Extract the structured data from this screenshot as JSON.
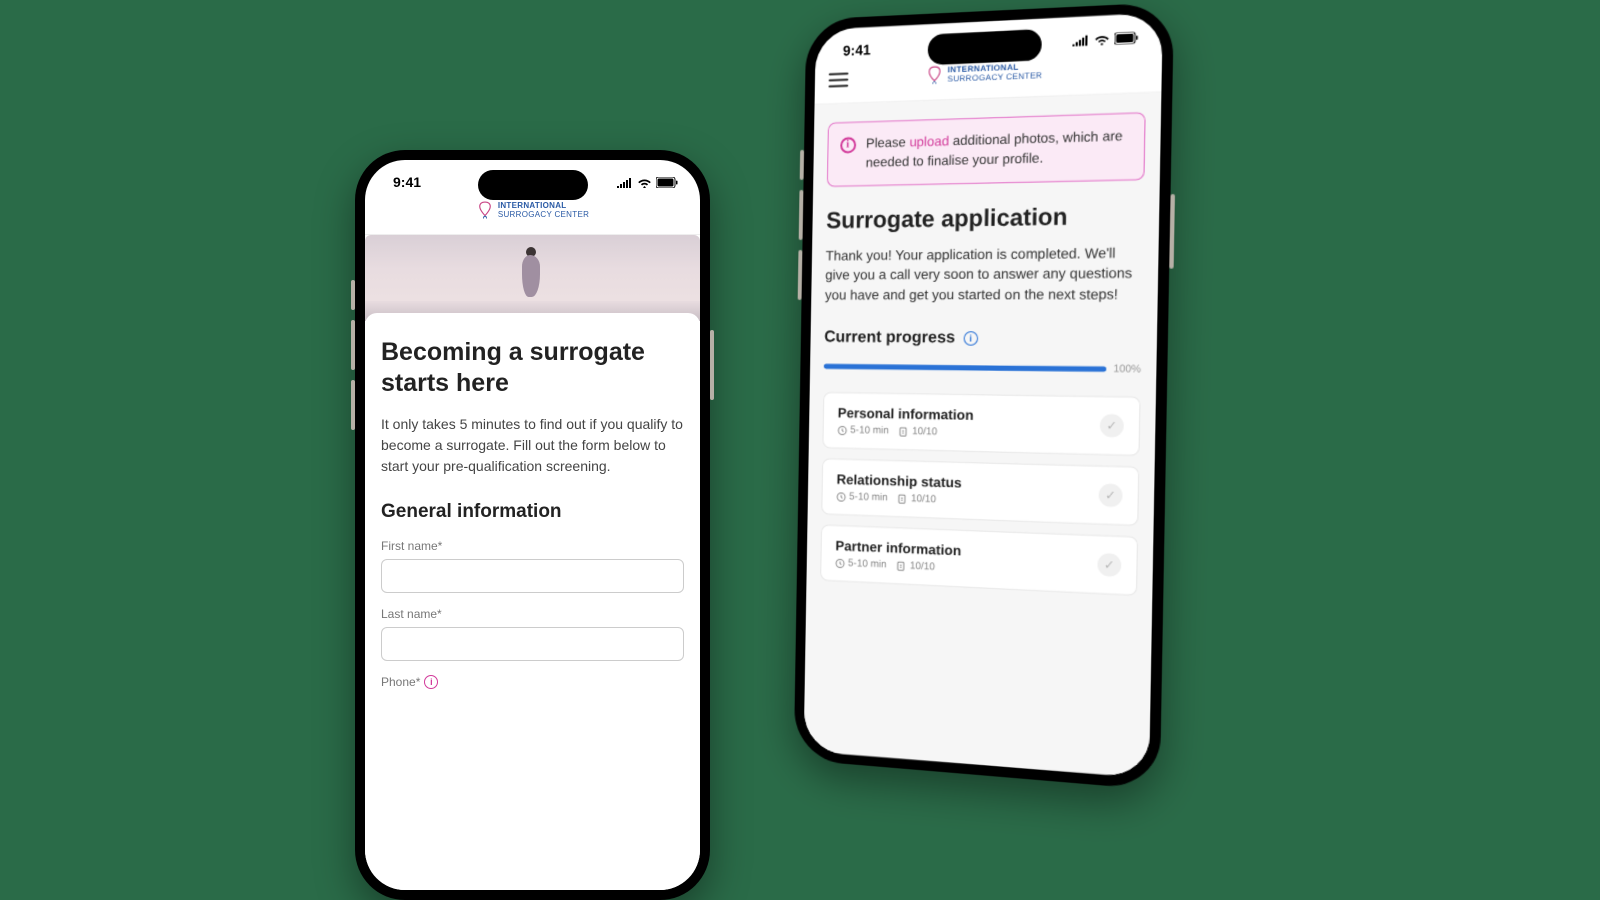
{
  "status": {
    "time": "9:41"
  },
  "logo": {
    "line1": "INTERNATIONAL",
    "line2": "SURROGACY CENTER"
  },
  "left": {
    "title": "Becoming a surrogate starts here",
    "subtitle": "It only takes 5 minutes to find out if you qualify to become a surrogate. Fill out the form below to start your pre-qualification screening.",
    "section": "General information",
    "labels": {
      "first": "First name*",
      "last": "Last name*",
      "phone": "Phone*"
    }
  },
  "right": {
    "alert_pre": "Please ",
    "alert_link": "upload",
    "alert_post": " additional photos, which are needed to finalise your profile.",
    "title": "Surrogate application",
    "body": "Thank you! Your application is completed. We'll give you a call very soon to answer any questions you have and get you started on the next steps!",
    "progress_label": "Current progress",
    "progress_pct": "100%",
    "steps": [
      {
        "title": "Personal information",
        "time": "5-10 min",
        "count": "10/10"
      },
      {
        "title": "Relationship status",
        "time": "5-10 min",
        "count": "10/10"
      },
      {
        "title": "Partner information",
        "time": "5-10 min",
        "count": "10/10"
      }
    ]
  }
}
